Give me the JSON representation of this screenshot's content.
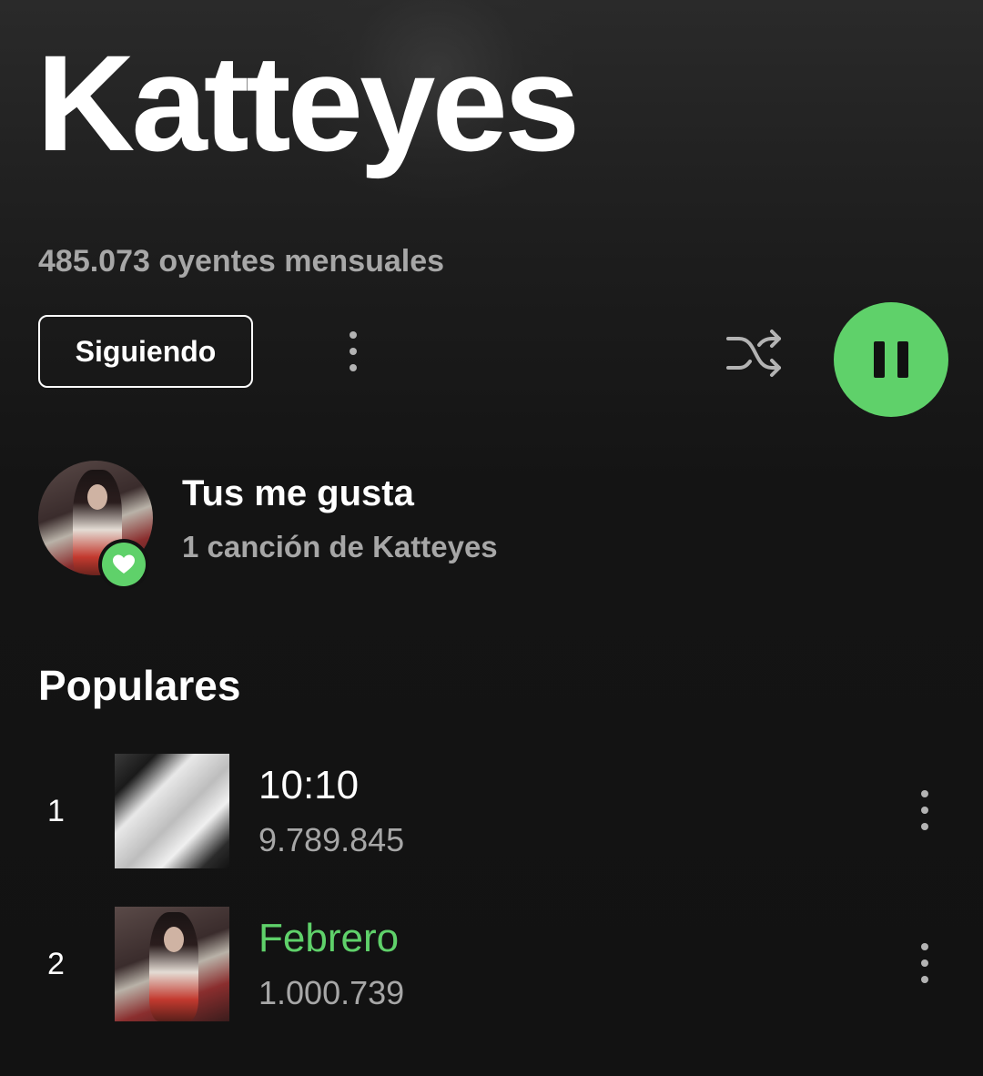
{
  "artist": {
    "name": "Katteyes",
    "monthly_listeners": "485.073 oyentes mensuales",
    "follow_label": "Siguiendo"
  },
  "controls": {
    "more_icon": "more-vert-icon",
    "shuffle_icon": "shuffle-icon",
    "play_state_icon": "pause-icon"
  },
  "liked": {
    "title": "Tus me gusta",
    "subtitle": "1 canción de Katteyes",
    "badge_icon": "heart-icon"
  },
  "popular": {
    "section_title": "Populares",
    "tracks": [
      {
        "rank": "1",
        "title": "10:10",
        "plays": "9.789.845",
        "playing": false
      },
      {
        "rank": "2",
        "title": "Febrero",
        "plays": "1.000.739",
        "playing": true
      }
    ]
  },
  "colors": {
    "accent": "#5fd16a",
    "background": "#121212",
    "secondary_text": "#a7a7a7"
  }
}
